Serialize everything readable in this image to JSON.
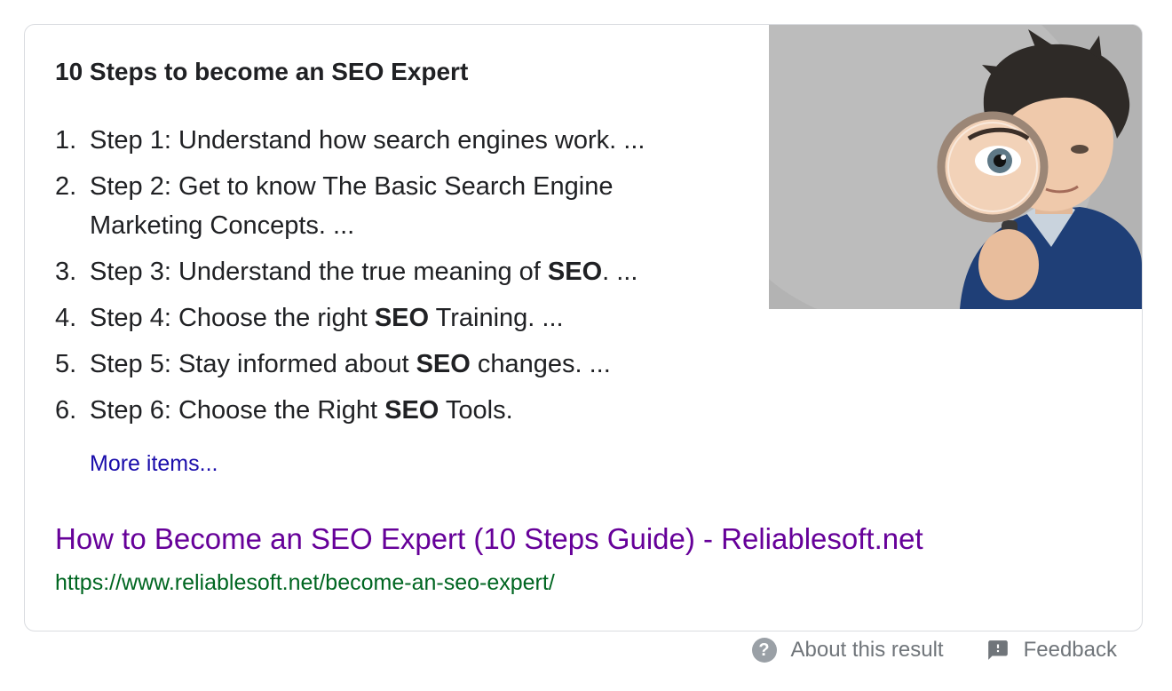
{
  "card": {
    "title": "10 Steps to become an SEO Expert",
    "steps": [
      {
        "num": "1.",
        "parts": [
          "Step 1: Understand how search engines work. ..."
        ]
      },
      {
        "num": "2.",
        "parts": [
          "Step 2: Get to know The Basic Search Engine Marketing Concepts. ..."
        ]
      },
      {
        "num": "3.",
        "parts": [
          "Step 3: Understand the true meaning of ",
          "SEO",
          ". ..."
        ]
      },
      {
        "num": "4.",
        "parts": [
          "Step 4: Choose the right ",
          "SEO",
          " Training. ..."
        ]
      },
      {
        "num": "5.",
        "parts": [
          "Step 5: Stay informed about ",
          "SEO",
          " changes. ..."
        ]
      },
      {
        "num": "6.",
        "parts": [
          "Step 6: Choose the Right ",
          "SEO",
          " Tools."
        ]
      }
    ],
    "more_items": "More items...",
    "result_title": "How to Become an SEO Expert (10 Steps Guide) - Reliablesoft.net",
    "result_url": "https://www.reliablesoft.net/become-an-seo-expert/",
    "image_alt": "man-with-magnifying-glass"
  },
  "footer": {
    "about_label": "About this result",
    "feedback_label": "Feedback"
  },
  "colors": {
    "title_text": "#202124",
    "more_link": "#1a0dab",
    "visited_link": "#660099",
    "url_green": "#006621",
    "footer_gray": "#70757a"
  },
  "icons": {
    "about": "help-circle-icon",
    "feedback": "feedback-icon"
  }
}
